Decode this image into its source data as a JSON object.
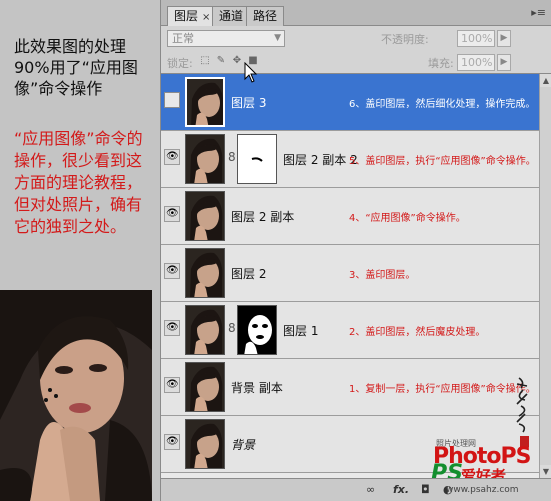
{
  "tutorial": {
    "intro": "此效果图的处理90%用了“应用图像”命令操作",
    "note": "“应用图像”命令的操作，很少看到这方面的理论教程，但对处照片，确有它的独到之处。"
  },
  "panel": {
    "tabs": [
      {
        "label": "图层",
        "close": "×"
      },
      {
        "label": "通道"
      },
      {
        "label": "路径"
      }
    ],
    "menu_icon": "▸≡",
    "blend_mode": "正常",
    "opacity_label": "不透明度:",
    "opacity_value": "100%",
    "lock_label": "锁定:",
    "fill_label": "填充:",
    "fill_value": "100%"
  },
  "layers": [
    {
      "name": "图层 3",
      "step": "6、盖印图层，然后细化处理，操作完成。",
      "selected": true,
      "visible": false
    },
    {
      "name": "图层 2 副本 2",
      "step": "5、盖印图层，执行“应用图像”命令操作。",
      "selected": false,
      "visible": true,
      "mask": true
    },
    {
      "name": "图层 2 副本",
      "step": "4、“应用图像”命令操作。",
      "selected": false,
      "visible": true
    },
    {
      "name": "图层 2",
      "step": "3、盖印图层。",
      "selected": false,
      "visible": true
    },
    {
      "name": "图层 1",
      "step": "2、盖印图层，然后魔皮处理。",
      "selected": false,
      "visible": true,
      "mask": true
    },
    {
      "name": "背景 副本",
      "step": "1、复制一层，执行“应用图像”命令操作。",
      "selected": false,
      "visible": true
    },
    {
      "name": "背景",
      "step": "",
      "selected": false,
      "visible": true
    }
  ],
  "bottom_bar": {
    "link": "∞",
    "fx": "fx.",
    "mask": "◘",
    "adjust": "◐",
    "folder": "▭",
    "new": "❐",
    "trash": "🗑"
  },
  "watermark": {
    "small": "照片处理网",
    "photops": "PhotoPS",
    "ps": "PS",
    "cn": "爱好者",
    "url": "www.psahz.com"
  },
  "icons": {
    "eye": "eye-icon",
    "chain": "chain-link-icon",
    "cursor": "cursor-icon"
  },
  "colors": {
    "selection": "#3a74d0",
    "step_text": "#d31a1a",
    "watermark_red": "#d21414",
    "watermark_green": "#138e2e"
  }
}
